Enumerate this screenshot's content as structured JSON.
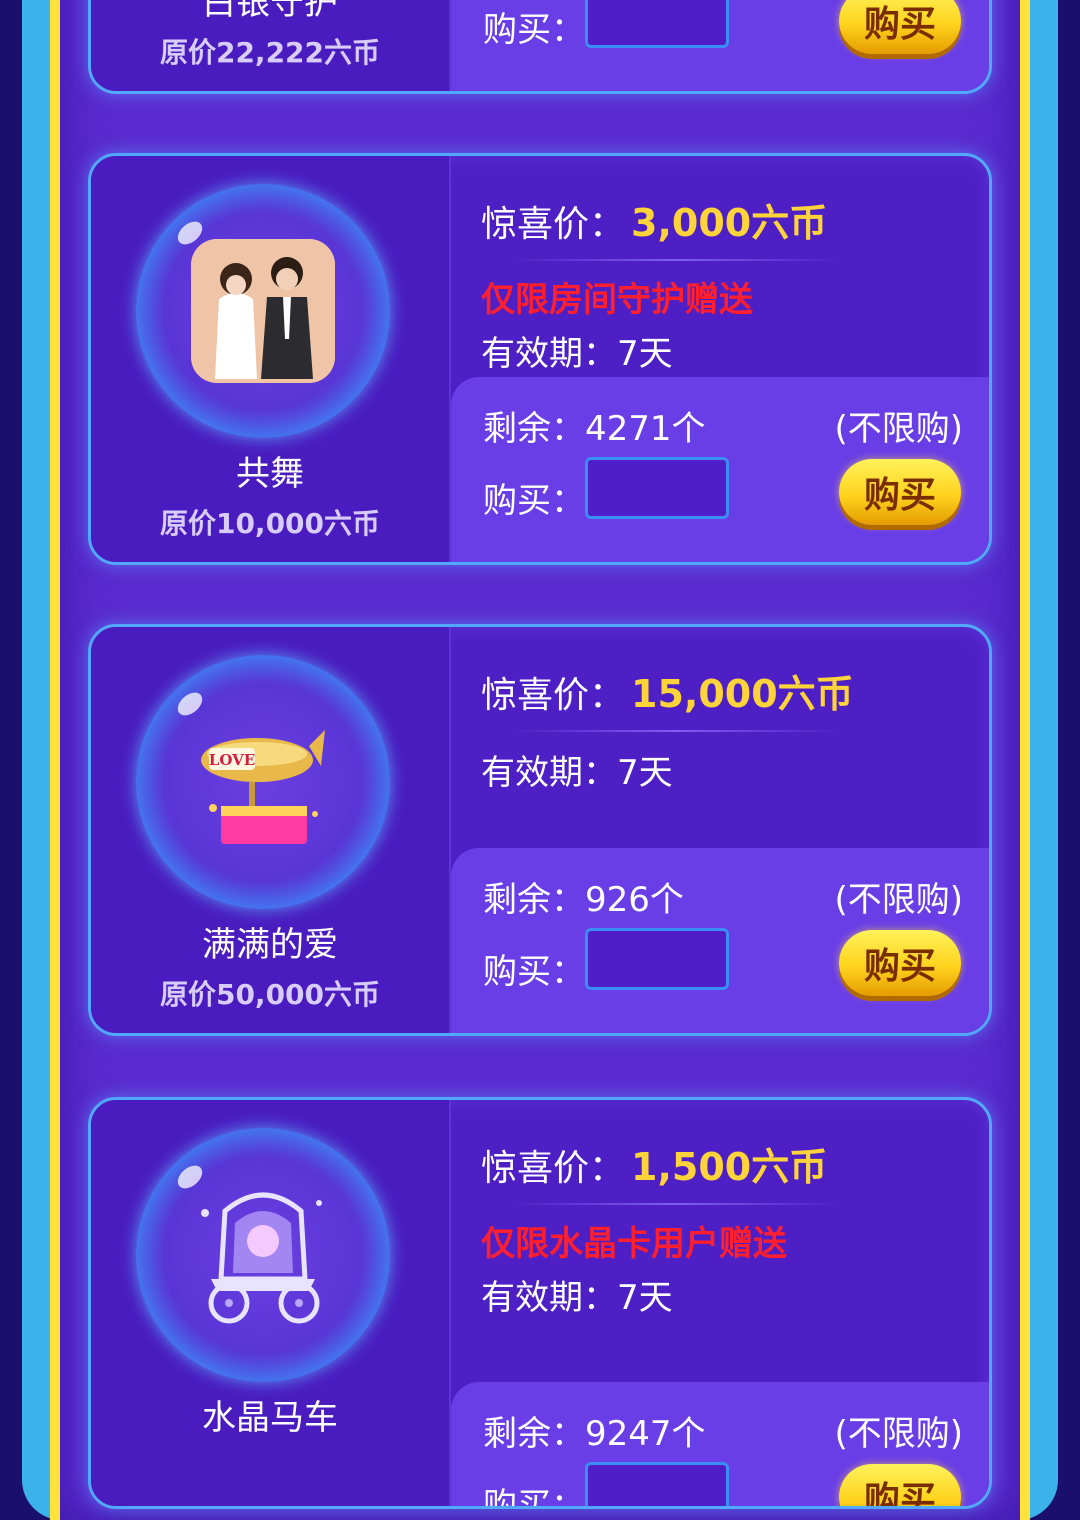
{
  "colors": {
    "background": "#1b0f6e",
    "frame_blue": "#3bb2ea",
    "frame_yellow": "#ffe23a",
    "card_border": "#52a8ff",
    "price_yellow": "#ffd43a",
    "restriction_red": "#ff1f2e",
    "buy_button": "#ffd31e"
  },
  "labels": {
    "surprise_price": "惊喜价：",
    "validity": "有效期：",
    "remaining": "剩余：",
    "buy": "购买：",
    "buy_button": "购买",
    "limit": "(不限购)"
  },
  "cards": [
    {
      "name": "白银守护",
      "original_price": "原价22,222六币",
      "icon": "guardian-icon"
    },
    {
      "name": "共舞",
      "original_price": "原价10,000六币",
      "surprise_price": "3,000六币",
      "restriction": "仅限房间守护赠送",
      "validity": "7天",
      "remaining": "4271个",
      "icon": "couple-dance-icon"
    },
    {
      "name": "满满的爱",
      "original_price": "原价50,000六币",
      "surprise_price": "15,000六币",
      "validity": "7天",
      "remaining": "926个",
      "icon": "love-airship-icon",
      "airship_text": "LOVE"
    },
    {
      "name": "水晶马车",
      "surprise_price": "1,500六币",
      "restriction": "仅限水晶卡用户赠送",
      "validity": "7天",
      "remaining": "9247个",
      "icon": "crystal-carriage-icon"
    }
  ]
}
